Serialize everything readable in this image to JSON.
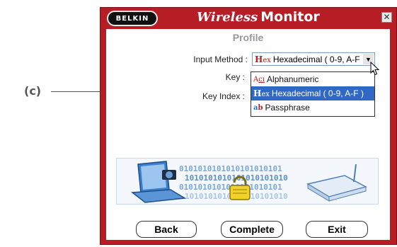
{
  "callout": {
    "label": "(c)"
  },
  "window": {
    "brand": "BELKIN",
    "title_italic": "Wireless",
    "title_bold": "Monitor",
    "close_glyph": "✕"
  },
  "profile": {
    "subtitle": "Profile",
    "input_method_label": "Input Method :",
    "key_label": "Key :",
    "key_index_label": "Key Index :",
    "input_method_value": "Hexadecimal ( 0-9, A-F",
    "dropdown_options": [
      {
        "icon": "Hex",
        "label": "Alphanumeric",
        "icon_glyph": "Aα"
      },
      {
        "icon": "Hex",
        "label": "Hexadecimal ( 0-9, A-F )",
        "icon_glyph": "H"
      },
      {
        "icon": "ab",
        "label": "Passphrase",
        "icon_glyph": "ab"
      }
    ],
    "selected_index": 1
  },
  "illustration": {
    "binary_rows": [
      "0101010101010101010101",
      "1010101010101010101010",
      "0101010101010101010101",
      "1010101010101010101010"
    ]
  },
  "buttons": {
    "back": "Back",
    "complete": "Complete",
    "exit": "Exit"
  },
  "colors": {
    "window_red": "#b61d25",
    "highlight": "#3168c6",
    "hex_icon": "#b32222"
  }
}
